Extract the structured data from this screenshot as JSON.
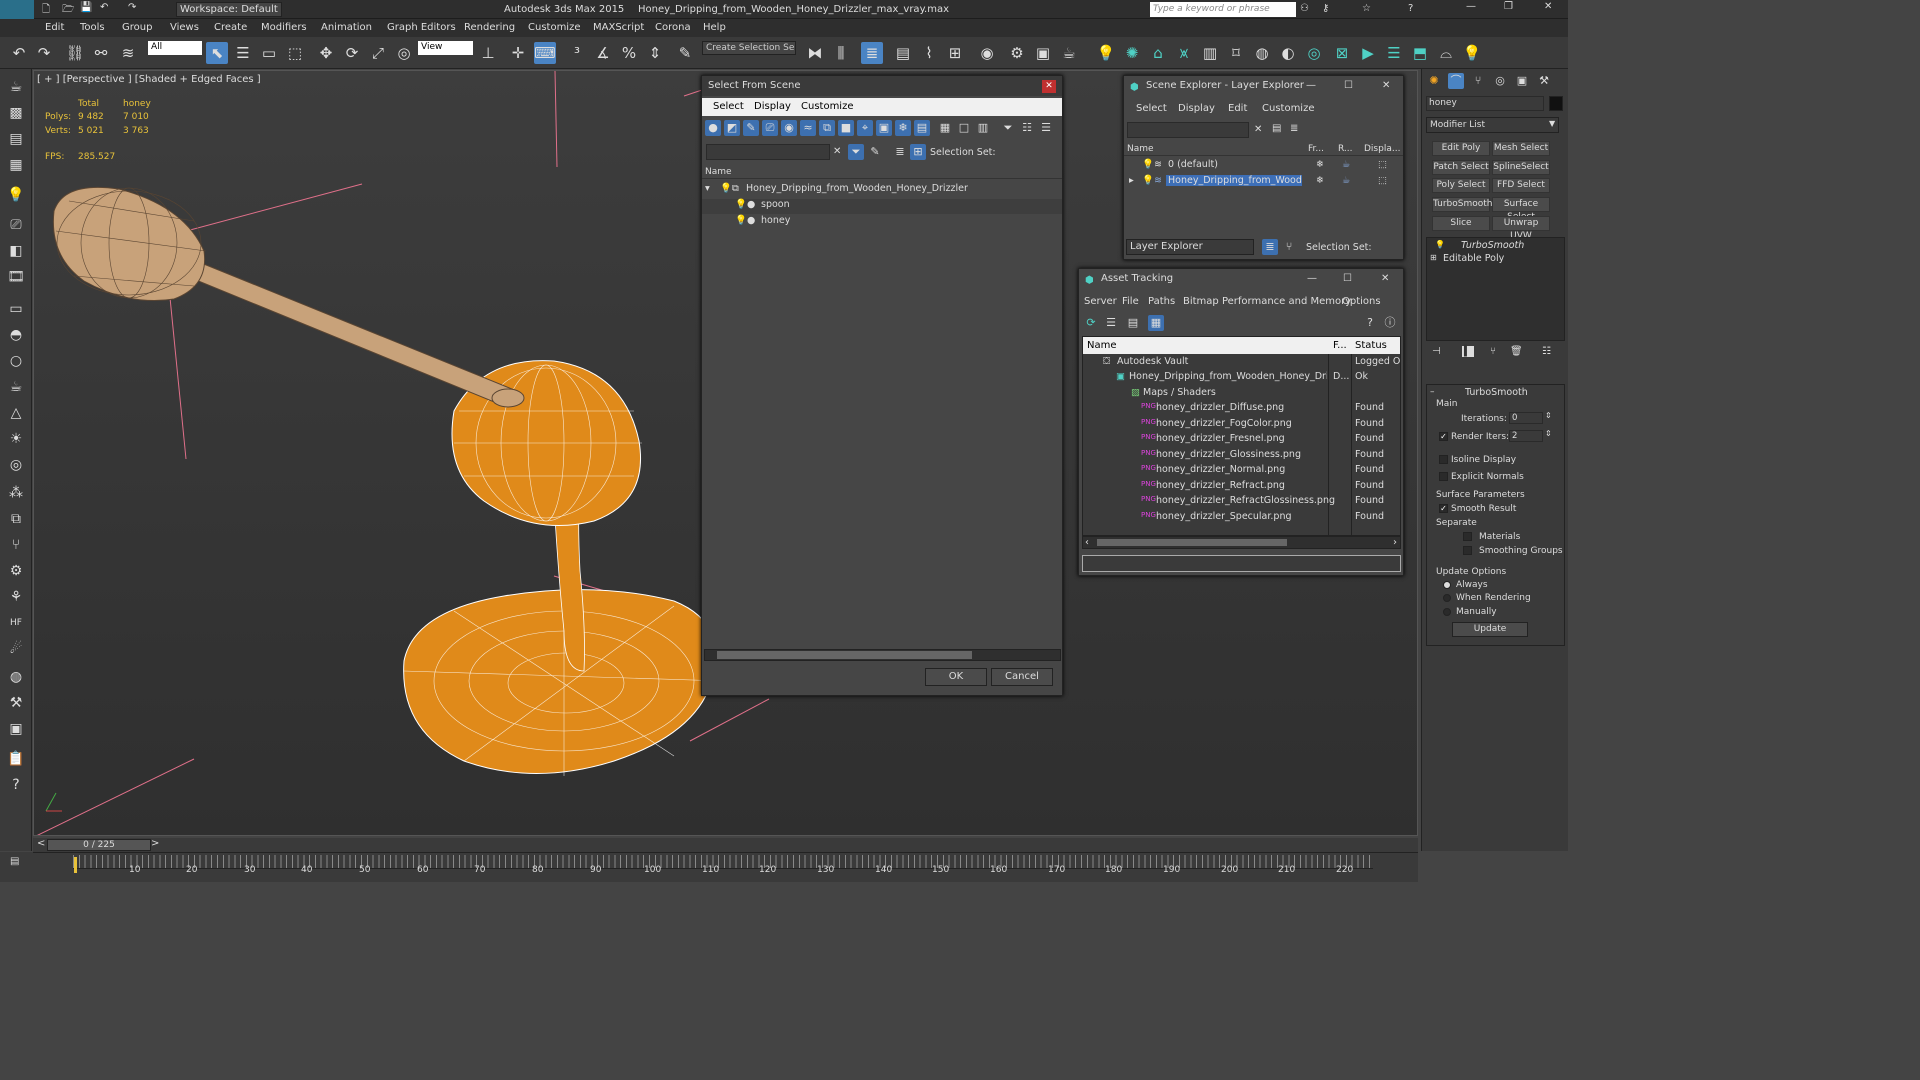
{
  "title": {
    "app": "Autodesk 3ds Max  2015",
    "file": "Honey_Dripping_from_Wooden_Honey_Drizzler_max_vray.max",
    "workspace": "Workspace: Default",
    "search_placeholder": "Type a keyword or phrase",
    "logo": "MAX"
  },
  "menu": [
    "Edit",
    "Tools",
    "Group",
    "Views",
    "Create",
    "Modifiers",
    "Animation",
    "Graph Editors",
    "Rendering",
    "Customize",
    "MAXScript",
    "Corona",
    "Help"
  ],
  "toolbar": {
    "filter": "All",
    "refcoord": "View",
    "selset": "Create Selection Se"
  },
  "viewport": {
    "label": "[ + ] [Perspective ] [Shaded + Edged Faces ]",
    "stats": {
      "total": "Total",
      "honey": "honey",
      "polys_label": "Polys:",
      "polys_total": "9 482",
      "polys_honey": "7 010",
      "verts_label": "Verts:",
      "verts_total": "5 021",
      "verts_honey": "3 763",
      "fps_label": "FPS:",
      "fps": "285.527"
    }
  },
  "select_dialog": {
    "title": "Select From Scene",
    "menu": [
      "Select",
      "Display",
      "Customize"
    ],
    "selset": "Selection Set:",
    "col_name": "Name",
    "tree": [
      "Honey_Dripping_from_Wooden_Honey_Drizzler",
      "spoon",
      "honey"
    ],
    "ok": "OK",
    "cancel": "Cancel"
  },
  "scene_explorer": {
    "title": "Scene Explorer - Layer Explorer",
    "menu": [
      "Select",
      "Display",
      "Edit",
      "Customize"
    ],
    "cols": [
      "Name",
      "Fr...",
      "R...",
      "Displa..."
    ],
    "rows": [
      "0 (default)",
      "Honey_Dripping_from_Wooden..."
    ],
    "footer": "Layer Explorer",
    "selset": "Selection Set:"
  },
  "asset_tracking": {
    "title": "Asset Tracking",
    "menu": [
      "Server",
      "File",
      "Paths",
      "Bitmap Performance and Memory",
      "Options"
    ],
    "cols": [
      "Name",
      "F...",
      "Status"
    ],
    "rows": [
      {
        "name": "Autodesk Vault",
        "f": "",
        "status": "Logged Ou"
      },
      {
        "name": "Honey_Dripping_from_Wooden_Honey_Driz...",
        "f": "D...",
        "status": "Ok"
      },
      {
        "name": "Maps / Shaders",
        "f": "",
        "status": ""
      },
      {
        "name": "honey_drizzler_Diffuse.png",
        "f": "",
        "status": "Found"
      },
      {
        "name": "honey_drizzler_FogColor.png",
        "f": "",
        "status": "Found"
      },
      {
        "name": "honey_drizzler_Fresnel.png",
        "f": "",
        "status": "Found"
      },
      {
        "name": "honey_drizzler_Glossiness.png",
        "f": "",
        "status": "Found"
      },
      {
        "name": "honey_drizzler_Normal.png",
        "f": "",
        "status": "Found"
      },
      {
        "name": "honey_drizzler_Refract.png",
        "f": "",
        "status": "Found"
      },
      {
        "name": "honey_drizzler_RefractGlossiness.png",
        "f": "",
        "status": "Found"
      },
      {
        "name": "honey_drizzler_Specular.png",
        "f": "",
        "status": "Found"
      }
    ]
  },
  "command_panel": {
    "object_name": "honey",
    "modifier_list": "Modifier List",
    "buttons": [
      "Edit Poly",
      "Mesh Select",
      "Patch Select",
      "SplineSelect",
      "Poly Select",
      "FFD Select",
      "TurboSmooth",
      "Surface Select",
      "Slice",
      "Unwrap UVW"
    ],
    "stack": [
      "TurboSmooth",
      "Editable Poly"
    ],
    "rollout": {
      "title": "TurboSmooth",
      "main": "Main",
      "iterations_label": "Iterations:",
      "iterations": "0",
      "render_iters_label": "Render Iters:",
      "render_iters": "2",
      "isoline": "Isoline Display",
      "explicit": "Explicit Normals",
      "surface": "Surface Parameters",
      "smooth": "Smooth Result",
      "separate": "Separate",
      "materials": "Materials",
      "smoothing": "Smoothing Groups",
      "update_options": "Update Options",
      "always": "Always",
      "when_rendering": "When Rendering",
      "manually": "Manually",
      "update": "Update"
    }
  },
  "timeline": {
    "frame": "0 / 225",
    "ticks": [
      "10",
      "20",
      "30",
      "40",
      "50",
      "60",
      "70",
      "80",
      "90",
      "100",
      "110",
      "120",
      "130",
      "140",
      "150",
      "160",
      "170",
      "180",
      "190",
      "200",
      "210",
      "220"
    ]
  },
  "colors": {
    "accent": "#4a84c4",
    "honey": "#e08a1a",
    "wood": "#c8a27a",
    "stats": "#e8c23a"
  }
}
